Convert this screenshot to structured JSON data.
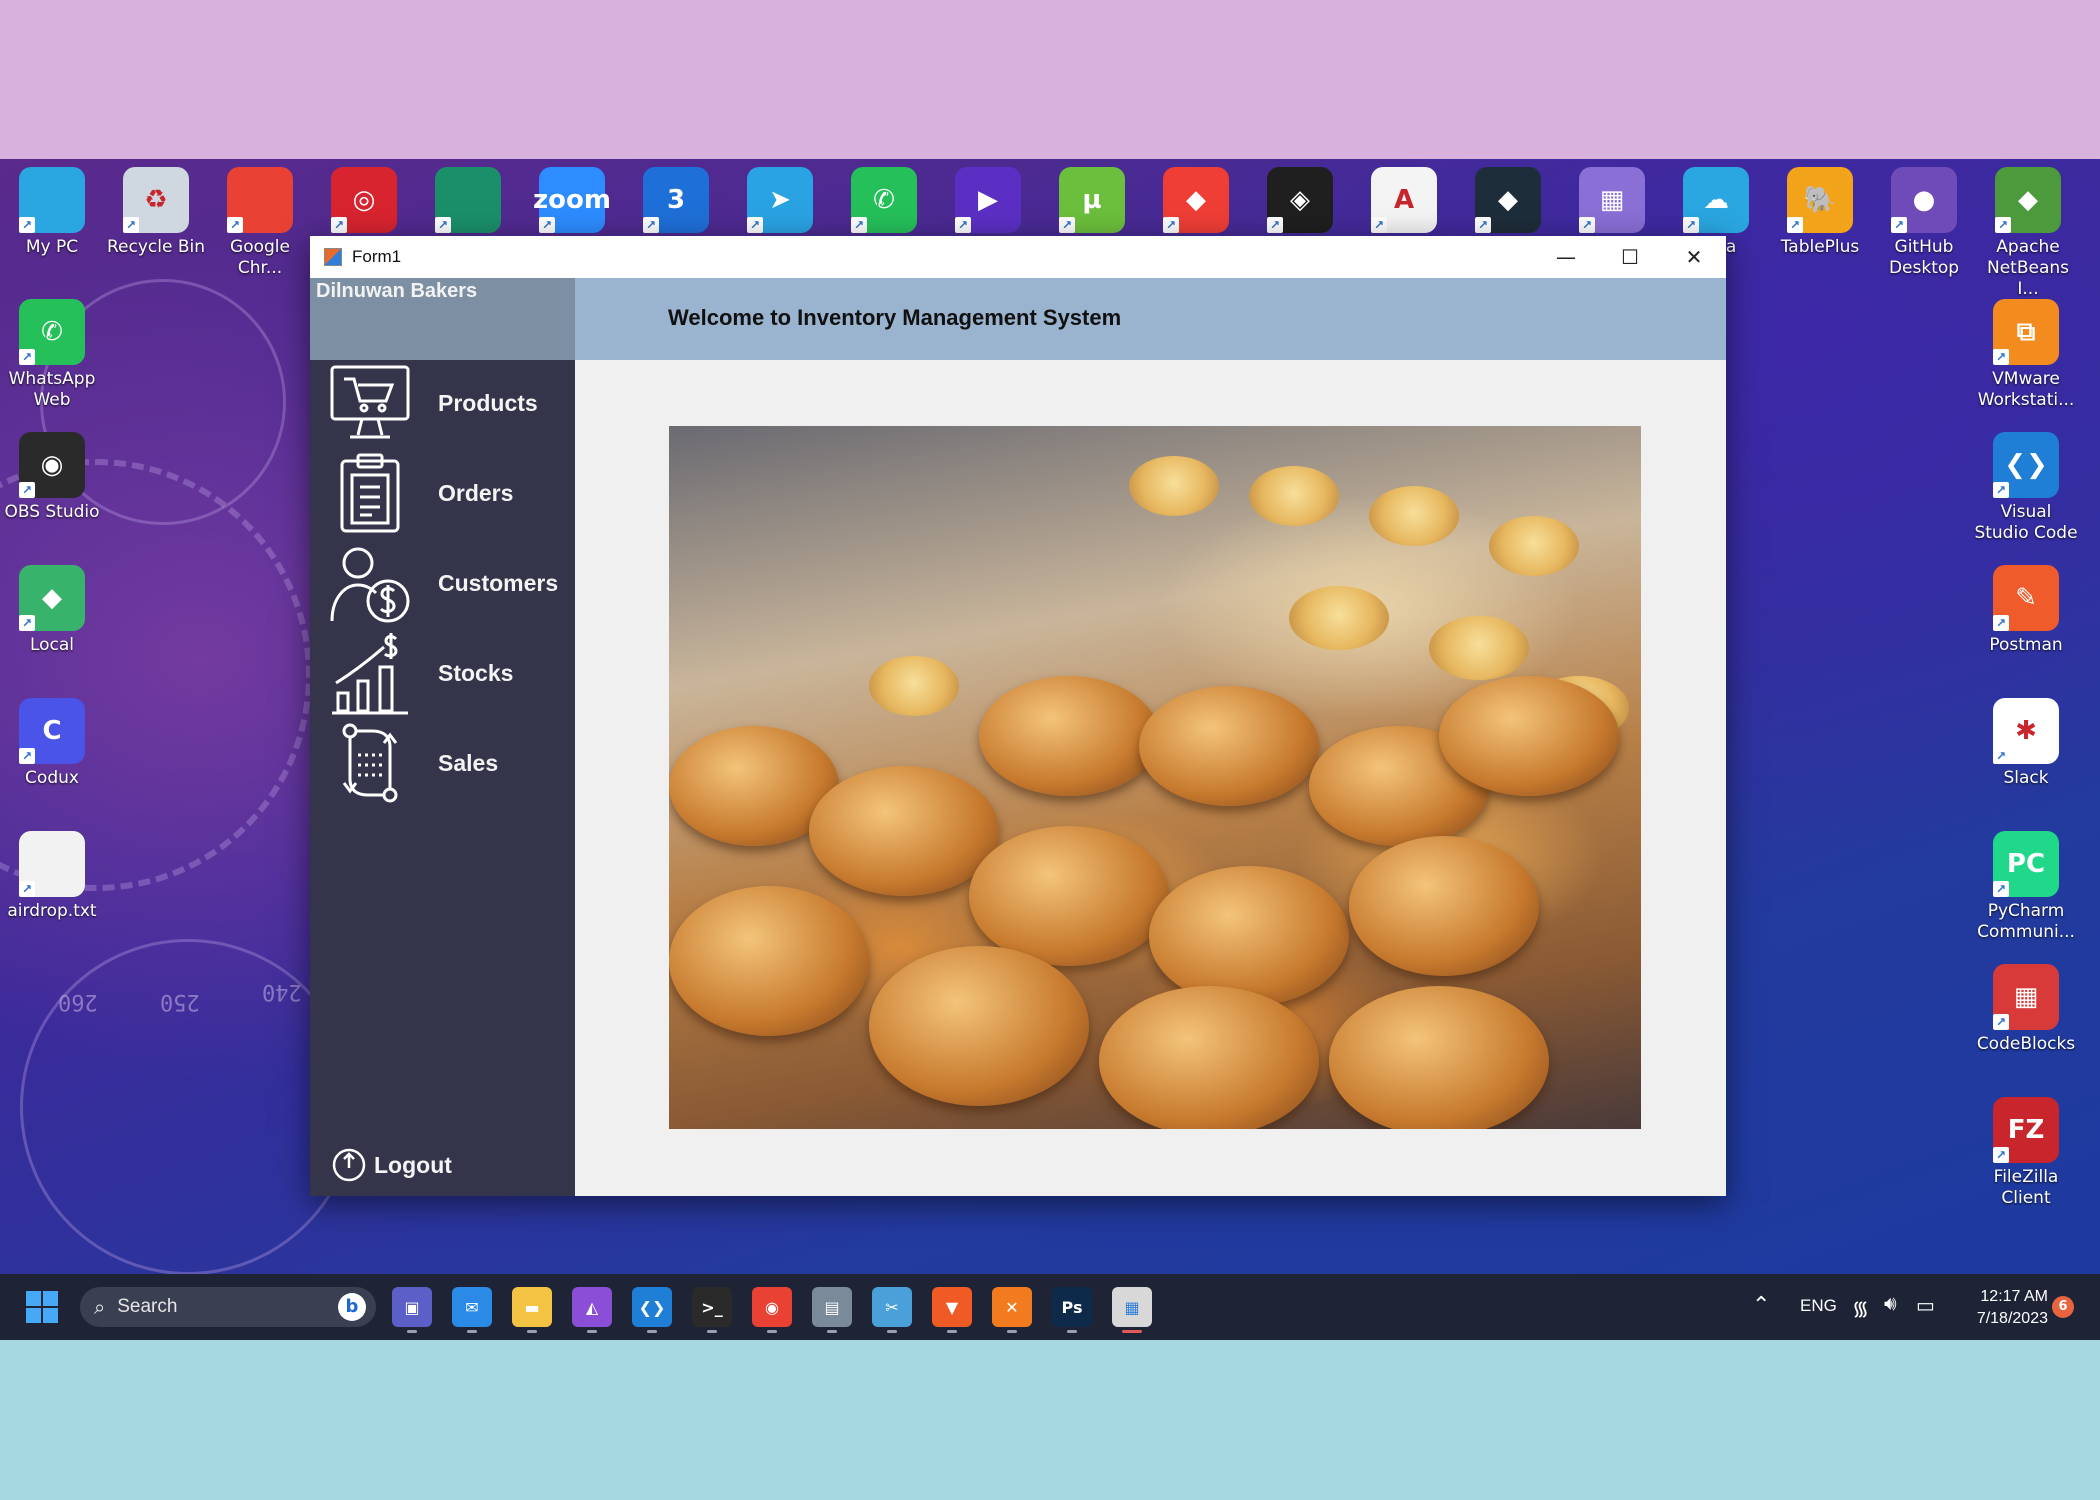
{
  "desktop": {
    "top_row": [
      {
        "label": "My PC",
        "icon": "monitor-icon",
        "color": "#2aa6e0",
        "glyph": ""
      },
      {
        "label": "Recycle Bin",
        "icon": "recycle-bin-icon",
        "color": "#cfd8e0",
        "glyph": "♻"
      },
      {
        "label": "Google Chr...",
        "icon": "chrome-icon",
        "color": "#e94235",
        "glyph": ""
      },
      {
        "label": "",
        "icon": "target-app-icon",
        "color": "#d8242f",
        "glyph": "◎"
      },
      {
        "label": "",
        "icon": "edge-icon",
        "color": "#1b8f6a",
        "glyph": ""
      },
      {
        "label": "",
        "icon": "zoom-icon",
        "color": "#2d8cff",
        "glyph": "zoom"
      },
      {
        "label": "",
        "icon": "app-three-icon",
        "color": "#1f6fd8",
        "glyph": "3"
      },
      {
        "label": "",
        "icon": "telegram-icon",
        "color": "#2aa3e3",
        "glyph": "➤"
      },
      {
        "label": "",
        "icon": "whatsapp-icon",
        "color": "#25c05a",
        "glyph": "✆"
      },
      {
        "label": "",
        "icon": "media-player-icon",
        "color": "#5b2fc4",
        "glyph": "▶"
      },
      {
        "label": "",
        "icon": "utorrent-icon",
        "color": "#6cbf3c",
        "glyph": "µ"
      },
      {
        "label": "",
        "icon": "anydesk-icon",
        "color": "#ef3e36",
        "glyph": "◆"
      },
      {
        "label": "",
        "icon": "binance-icon",
        "color": "#1f1f1f",
        "glyph": "◈"
      },
      {
        "label": "",
        "icon": "autocad-icon",
        "color": "#f4f4f4",
        "glyph": "A"
      },
      {
        "label": "",
        "icon": "filmora-icon",
        "color": "#1e2d3a",
        "glyph": "◆"
      },
      {
        "label": "",
        "icon": "office-building-icon",
        "color": "#8a6fd6",
        "glyph": "▦"
      },
      {
        "label": "Data",
        "icon": "data-studio-icon",
        "color": "#2aa6e0",
        "glyph": "☁"
      },
      {
        "label": "TablePlus",
        "icon": "tableplus-icon",
        "color": "#f3a31a",
        "glyph": "🐘"
      },
      {
        "label": "GitHub Desktop",
        "icon": "github-icon",
        "color": "#6e4bb8",
        "glyph": "●"
      },
      {
        "label": "Apache NetBeans I...",
        "icon": "netbeans-icon",
        "color": "#4c9a3c",
        "glyph": "◆"
      }
    ],
    "left_col": [
      {
        "label": "WhatsApp Web",
        "icon": "whatsapp-web-icon",
        "color": "#25c05a",
        "glyph": "✆"
      },
      {
        "label": "OBS Studio",
        "icon": "obs-icon",
        "color": "#2a2a2a",
        "glyph": "◉"
      },
      {
        "label": "Local",
        "icon": "local-icon",
        "color": "#37b36b",
        "glyph": "◆"
      },
      {
        "label": "Codux",
        "icon": "codux-icon",
        "color": "#4a54e8",
        "glyph": "C"
      },
      {
        "label": "airdrop.txt",
        "icon": "text-file-icon",
        "color": "#f2f2f2",
        "glyph": ""
      }
    ],
    "right_col": [
      {
        "label": "VMware Workstati...",
        "icon": "vmware-icon",
        "color": "#f38b1f",
        "glyph": "⧉"
      },
      {
        "label": "Visual Studio Code",
        "icon": "vscode-icon",
        "color": "#1f7fd6",
        "glyph": "❮❯"
      },
      {
        "label": "Postman",
        "icon": "postman-icon",
        "color": "#ef5b2b",
        "glyph": "✎"
      },
      {
        "label": "Slack",
        "icon": "slack-icon",
        "color": "#ffffff",
        "glyph": "✱"
      },
      {
        "label": "PyCharm Communi...",
        "icon": "pycharm-icon",
        "color": "#21d789",
        "glyph": "PC"
      },
      {
        "label": "CodeBlocks",
        "icon": "codeblocks-icon",
        "color": "#d83a3a",
        "glyph": "▦"
      },
      {
        "label": "FileZilla Client",
        "icon": "filezilla-icon",
        "color": "#c8252c",
        "glyph": "FZ"
      }
    ],
    "wallpaper_numbers": [
      "260",
      "250",
      "240"
    ]
  },
  "window": {
    "title": "Form1",
    "controls": {
      "minimize": "—",
      "maximize": "☐",
      "close": "✕"
    }
  },
  "app": {
    "brand": "Dilnuwan Bakers",
    "header_title": "Welcome to Inventory Management System",
    "nav": [
      {
        "label": "Products",
        "icon": "cart-monitor-icon"
      },
      {
        "label": "Orders",
        "icon": "clipboard-icon"
      },
      {
        "label": "Customers",
        "icon": "customer-dollar-icon"
      },
      {
        "label": "Stocks",
        "icon": "stocks-chart-icon"
      },
      {
        "label": "Sales",
        "icon": "sales-flow-icon"
      }
    ],
    "logout": "Logout",
    "image": "bakery-pastries-photo"
  },
  "taskbar": {
    "search_placeholder": "Search",
    "language": "ENG",
    "time": "12:17 AM",
    "date": "7/18/2023",
    "notification_count": "6",
    "apps": [
      {
        "name": "teams-icon",
        "color": "#5b5fc7",
        "glyph": "▣"
      },
      {
        "name": "mail-icon",
        "color": "#2b8ae6",
        "glyph": "✉"
      },
      {
        "name": "file-explorer-icon",
        "color": "#f5c342",
        "glyph": "▬"
      },
      {
        "name": "visual-studio-icon",
        "color": "#8a4fd6",
        "glyph": "◭"
      },
      {
        "name": "vscode-taskbar-icon",
        "color": "#1f7fd6",
        "glyph": "❮❯"
      },
      {
        "name": "terminal-icon",
        "color": "#2a2a2a",
        "glyph": ">_"
      },
      {
        "name": "chrome-taskbar-icon",
        "color": "#e94235",
        "glyph": "◉"
      },
      {
        "name": "disk-tool-icon",
        "color": "#7a8a9a",
        "glyph": "▤"
      },
      {
        "name": "snipping-tool-icon",
        "color": "#4aa0d8",
        "glyph": "✂"
      },
      {
        "name": "brave-icon",
        "color": "#f05a24",
        "glyph": "▼"
      },
      {
        "name": "xampp-icon",
        "color": "#f27b1f",
        "glyph": "✕"
      },
      {
        "name": "photoshop-icon",
        "color": "#0d2a4a",
        "glyph": "Ps"
      },
      {
        "name": "winforms-app-icon",
        "color": "#d8d8d8",
        "glyph": "▦"
      }
    ]
  }
}
